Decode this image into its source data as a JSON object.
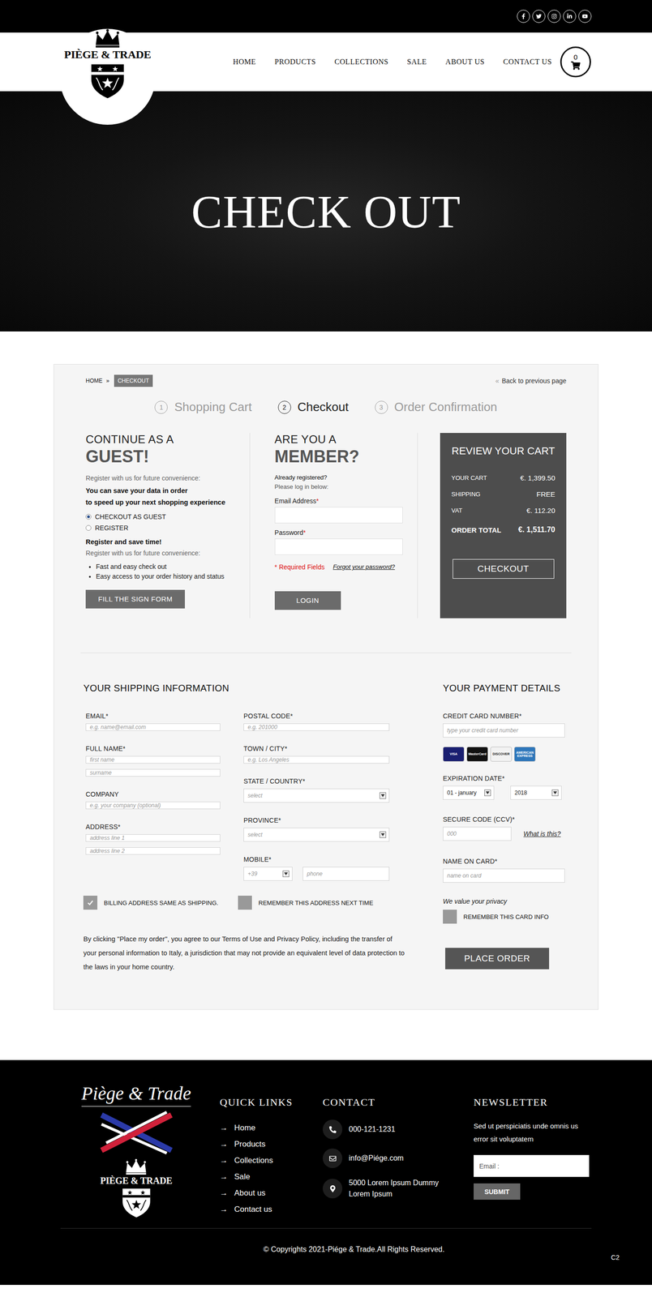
{
  "header": {
    "logo_text": "PIÈGE & TRADE",
    "nav": [
      "HOME",
      "PRODUCTS",
      "COLLECTIONS",
      "SALE",
      "ABOUT US",
      "CONTACT US"
    ],
    "cart_count": "0"
  },
  "hero": {
    "title": "CHECK OUT"
  },
  "breadcrumb": {
    "items": [
      {
        "label": "HOME",
        "selected": false
      },
      {
        "label": "CHECKOUT",
        "selected": true
      }
    ],
    "separator": "»",
    "back_icon": "«",
    "back_label": "Back to previous page"
  },
  "steps": [
    {
      "number": "1",
      "label": "Shopping Cart",
      "selected": false
    },
    {
      "number": "2",
      "label": "Checkout",
      "selected": true
    },
    {
      "number": "3",
      "label": "Order Confirmation",
      "selected": false
    }
  ],
  "guest": {
    "heading": "CONTINUE AS A",
    "title": "GUEST!",
    "intro": "Register with us for future convenience:",
    "save_lines": [
      "You can save your data in order",
      "to speed up your next shopping experience"
    ],
    "options": [
      {
        "label": "CHECKOUT AS GUEST",
        "selected": true
      },
      {
        "label": "REGISTER",
        "selected": false
      }
    ],
    "save_title": "Register and save time!",
    "save_sub": "Register with us for future convenience:",
    "benefits": [
      "Fast and easy check out",
      "Easy access to your order history and status"
    ],
    "button": "FILL THE SIGN FORM"
  },
  "member": {
    "heading": "ARE YOU A",
    "title": "MEMBER?",
    "already": "Already registered?",
    "please": "Please log in below:",
    "fields": [
      {
        "label": "Email Address",
        "mark": "*"
      },
      {
        "label": "Password",
        "mark": "*"
      }
    ],
    "required_note": "* Required Fields",
    "forgot": "Forgot your password?",
    "button": "LOGIN"
  },
  "review": {
    "title": "REVIEW YOUR CART",
    "rows": [
      {
        "label": "YOUR CART",
        "value": "€. 1,399.50",
        "total": false
      },
      {
        "label": "SHIPPING",
        "value": "FREE",
        "total": false
      },
      {
        "label": "VAT",
        "value": "€. 112.20",
        "total": false
      },
      {
        "label": "ORDER TOTAL",
        "value": "€. 1,511.70",
        "total": true
      }
    ],
    "button": "CHECKOUT"
  },
  "shipping": {
    "title": "YOUR SHIPPING INFORMATION",
    "left": [
      {
        "label": "EMAIL*",
        "controls": [
          {
            "kind": "input",
            "placeholder": "e.g. name@email.com"
          }
        ]
      },
      {
        "label": "FULL NAME*",
        "controls": [
          {
            "kind": "input",
            "placeholder": "first name"
          },
          {
            "kind": "input",
            "placeholder": "surname"
          }
        ]
      },
      {
        "label": "COMPANY",
        "controls": [
          {
            "kind": "input",
            "placeholder": "e.g. your company (optional)"
          }
        ]
      },
      {
        "label": "ADDRESS*",
        "controls": [
          {
            "kind": "input",
            "placeholder": "address line 1"
          },
          {
            "kind": "input",
            "placeholder": "address line 2"
          }
        ]
      }
    ],
    "right": [
      {
        "label": "POSTAL CODE*",
        "controls": [
          {
            "kind": "input",
            "placeholder": "e.g. 201000"
          }
        ]
      },
      {
        "label": "TOWN / CITY*",
        "controls": [
          {
            "kind": "input",
            "placeholder": "e.g. Los Angeles"
          }
        ]
      },
      {
        "label": "STATE / COUNTRY*",
        "controls": [
          {
            "kind": "select",
            "placeholder": "select"
          }
        ]
      },
      {
        "label": "PROVINCE*",
        "controls": [
          {
            "kind": "select",
            "placeholder": "select"
          }
        ]
      },
      {
        "label": "MOBILE*",
        "controls": [
          {
            "kind": "code",
            "placeholder": "+39"
          },
          {
            "kind": "input",
            "placeholder": "phone"
          }
        ]
      }
    ],
    "checkboxes": [
      {
        "label": "BILLING ADDRESS SAME AS SHIPPING.",
        "checked": true
      },
      {
        "label": "REMEMBER THIS ADDRESS NEXT TIME",
        "checked": false
      }
    ],
    "terms": "By clicking \"Place my order\", you agree to our Terms of Use and Privacy Policy, including the transfer of your personal information to Italy, a jurisdiction that may not provide an equivalent level of data protection to the laws in your home country."
  },
  "payment": {
    "title": "YOUR PAYMENT DETAILS",
    "card_label": "CREDIT CARD NUMBER*",
    "card_placeholder": "type your credit card number",
    "cards": [
      {
        "name": "VISA",
        "color": "#1a1f71"
      },
      {
        "name": "MasterCard",
        "color": "#111111"
      },
      {
        "name": "DISCOVER",
        "color": "#f2f2f2"
      },
      {
        "name": "AMERICAN EXPRESS",
        "color": "#2e77bb"
      }
    ],
    "expiry_label": "EXPIRATION DATE*",
    "expiry": [
      "01 - january",
      "2018"
    ],
    "ccv_label": "SECURE CODE (CCV)*",
    "ccv_placeholder": "000",
    "ccv_help": "What is this?",
    "name_label": "NAME ON CARD*",
    "name_placeholder": "name on card",
    "privacy": "We value your privacy",
    "remember": {
      "label": "REMEMBER THIS CARD INFO",
      "checked": false
    },
    "button": "PLACE ORDER"
  },
  "footer": {
    "brand_script": "Piège & Trade",
    "crest_text": "PIÈGE & TRADE",
    "quick_links": {
      "title": "QUICK LINKS",
      "arrow": "→",
      "items": [
        "Home",
        "Products",
        "Collections",
        "Sale",
        "About us",
        "Contact us"
      ]
    },
    "contact": {
      "title": "CONTACT",
      "items": [
        {
          "kind": "phone",
          "text": "000-121-1231"
        },
        {
          "kind": "email",
          "text": "info@Piége.com"
        },
        {
          "kind": "address",
          "text": "5000 Lorem Ipsum Dummy Lorem Ipsum"
        }
      ]
    },
    "newsletter": {
      "title": "NEWSLETTER",
      "text": "Sed ut perspiciatis unde omnis us error sit voluptatem",
      "placeholder": "Email :",
      "button": "SUBMIT"
    },
    "copyright": "© Copyrights 2021-Piége & Trade.All Rights Reserved.",
    "corner": "C2"
  }
}
